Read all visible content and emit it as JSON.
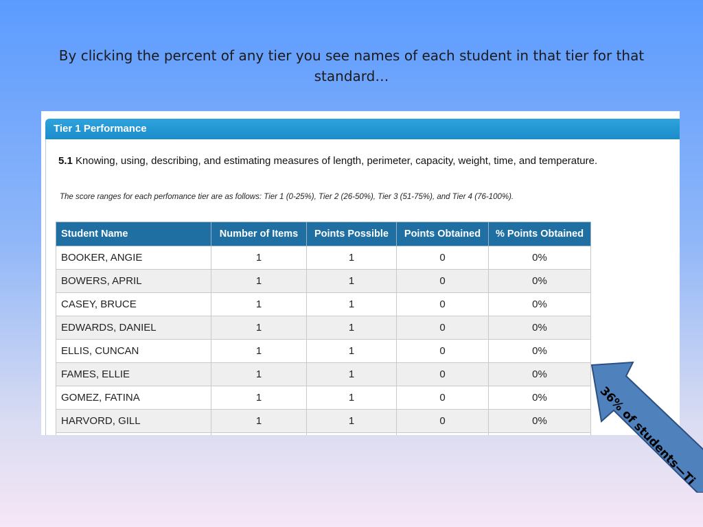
{
  "slide": {
    "title": "By clicking the percent of any tier you see names of each student in that tier for that standard…"
  },
  "panel": {
    "title": "Tier 1 Performance",
    "standard_number": "5.1",
    "standard_text": "Knowing, using, describing, and estimating measures of length, perimeter, capacity, weight, time, and temperature.",
    "tier_note": "The score ranges for each perfomance tier are as follows: Tier 1 (0-25%), Tier 2 (26-50%), Tier 3 (51-75%), and Tier 4 (76-100%)."
  },
  "table": {
    "headers": [
      "Student Name",
      "Number of Items",
      "Points Possible",
      "Points Obtained",
      "% Points Obtained"
    ],
    "rows": [
      [
        "BOOKER, ANGIE",
        "1",
        "1",
        "0",
        "0%"
      ],
      [
        "BOWERS, APRIL",
        "1",
        "1",
        "0",
        "0%"
      ],
      [
        "CASEY, BRUCE",
        "1",
        "1",
        "0",
        "0%"
      ],
      [
        "EDWARDS, DANIEL",
        "1",
        "1",
        "0",
        "0%"
      ],
      [
        "ELLIS, CUNCAN",
        "1",
        "1",
        "0",
        "0%"
      ],
      [
        "FAMES, ELLIE",
        "1",
        "1",
        "0",
        "0%"
      ],
      [
        "GOMEZ, FATINA",
        "1",
        "1",
        "0",
        "0%"
      ],
      [
        "HARVORD, GILL",
        "1",
        "1",
        "0",
        "0%"
      ]
    ]
  },
  "callout": {
    "text": "36% of students—Ti"
  },
  "colors": {
    "header_blue": "#1f6fa3",
    "panel_header": "#1a8ccb",
    "arrow_fill": "#4f81bd"
  }
}
